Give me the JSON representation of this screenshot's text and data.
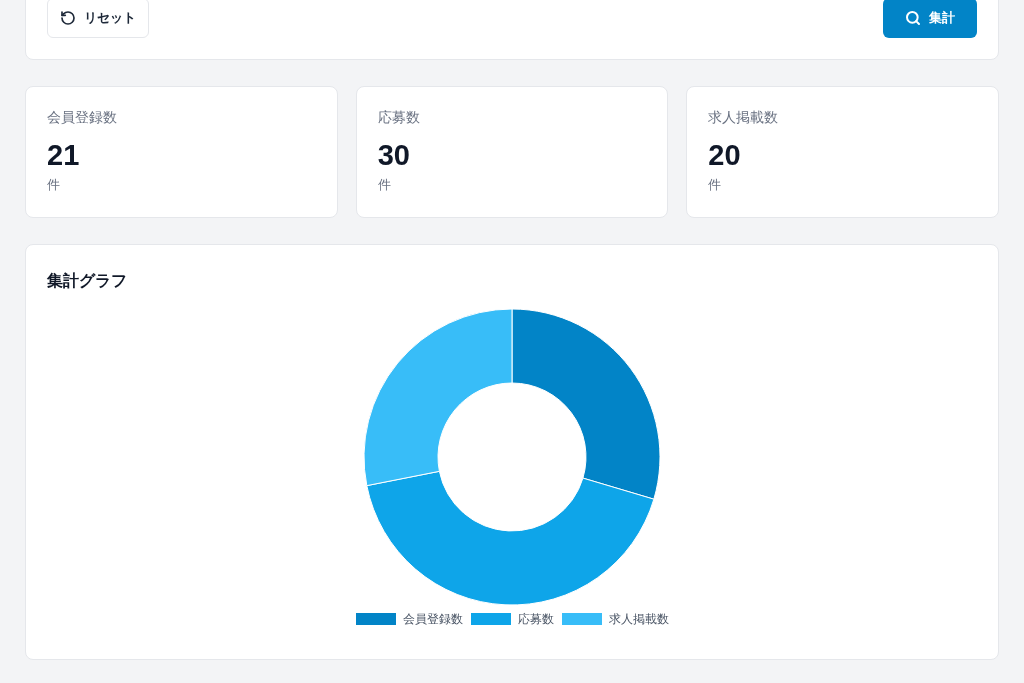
{
  "toolbar": {
    "buttons": [
      {
        "label": "リセット",
        "kind": "reset"
      },
      {
        "label": "集計",
        "kind": "search"
      }
    ]
  },
  "stats": [
    {
      "label": "会員登録数",
      "value": "21",
      "unit": "件"
    },
    {
      "label": "応募数",
      "value": "30",
      "unit": "件"
    },
    {
      "label": "求人掲載数",
      "value": "20",
      "unit": "件"
    }
  ],
  "chart_card": {
    "chart_data": {
      "type": "donut",
      "title": "集計グラフ",
      "categories": [
        "会員登録数",
        "応募数",
        "求人掲載数"
      ],
      "values": [
        29.6,
        42.3,
        28.1
      ],
      "colors": [
        "#0284c7",
        "#0ea5e9",
        "#38bdf8"
      ],
      "legend": "bottom"
    }
  }
}
